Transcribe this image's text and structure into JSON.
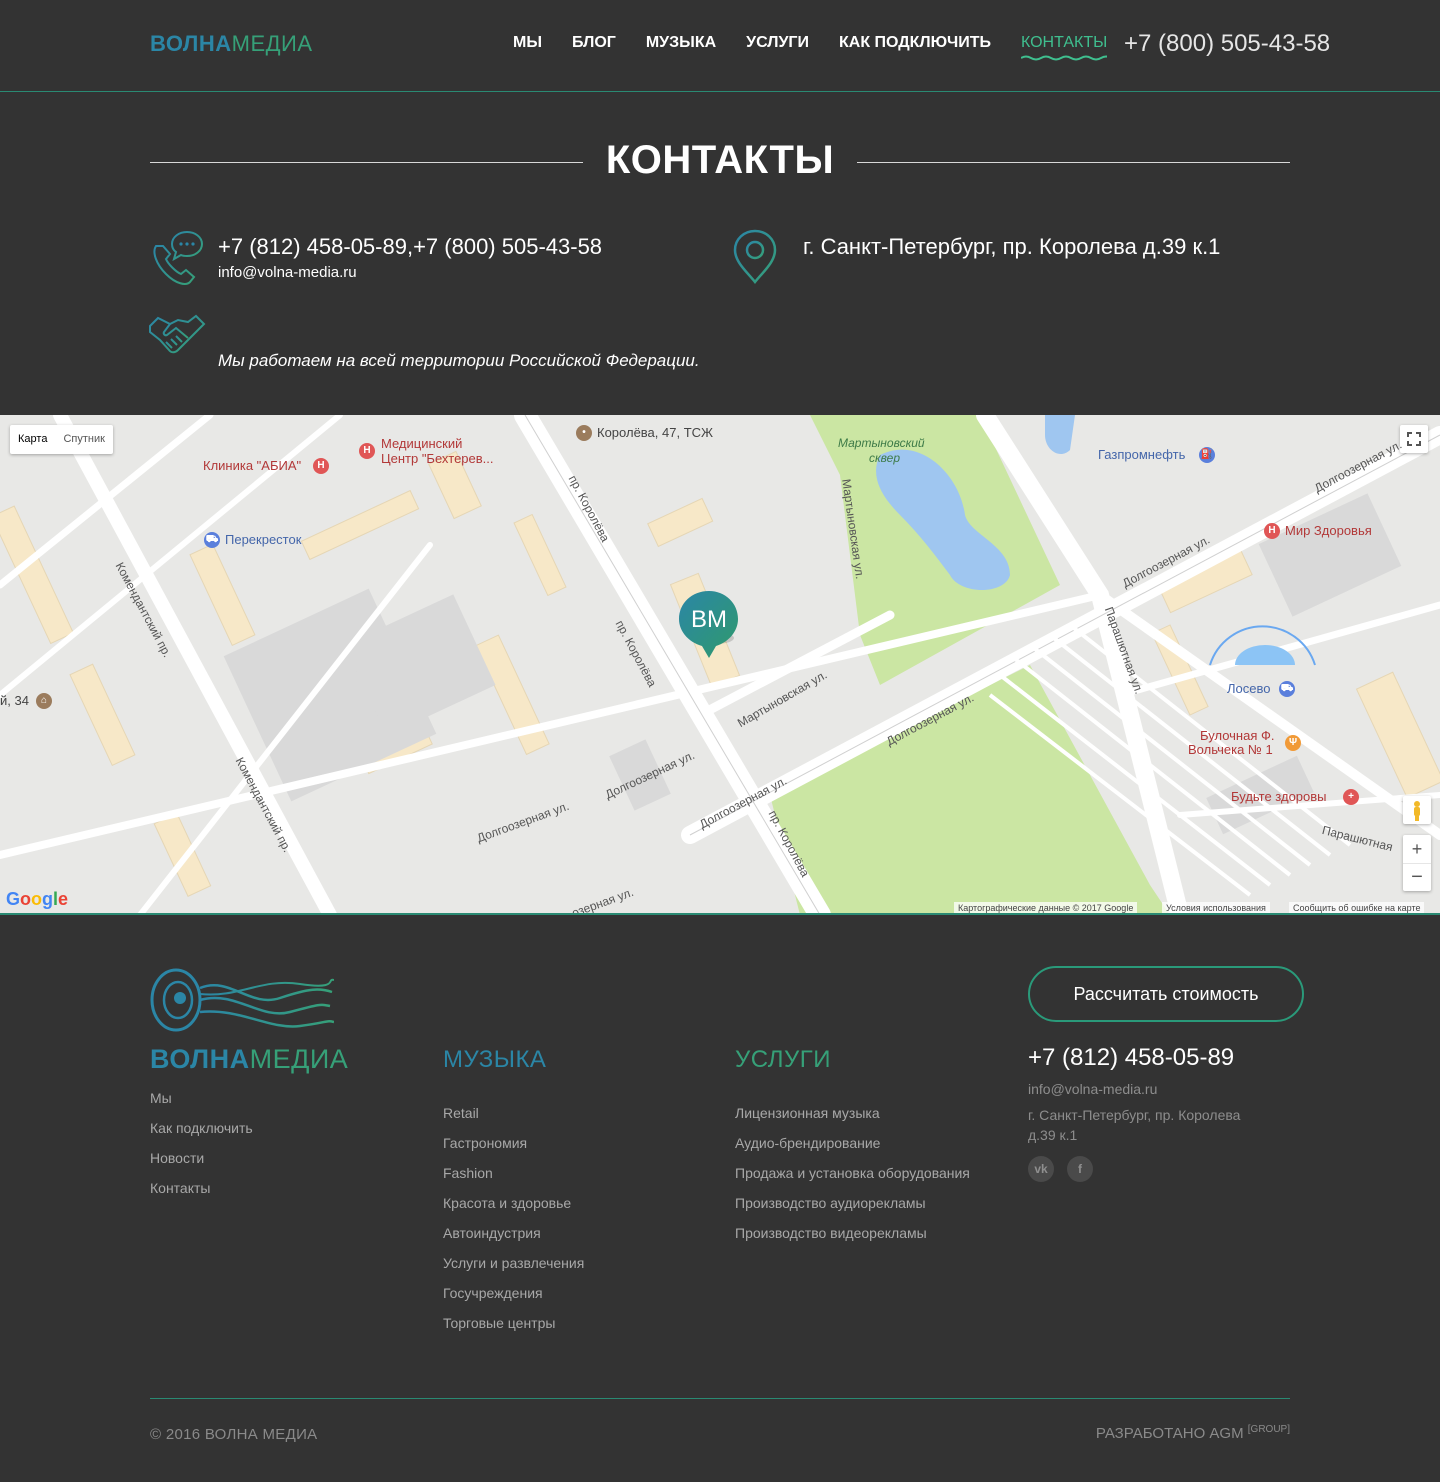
{
  "header": {
    "logo_bold": "ВОЛНА",
    "logo_light": "МЕДИА",
    "nav": [
      "МЫ",
      "БЛОГ",
      "МУЗЫКА",
      "УСЛУГИ",
      "КАК ПОДКЛЮЧИТЬ",
      "КОНТАКТЫ"
    ],
    "phone": "+7 (800) 505-43-58"
  },
  "page": {
    "title": "КОНТАКТЫ",
    "phones": "+7 (812) 458-05-89,+7 (800) 505-43-58",
    "email": "info@volna-media.ru",
    "address": "г. Санкт-Петербург, пр. Королева д.39 к.1",
    "territory": "Мы работаем на всей территории Российской Федерации."
  },
  "map": {
    "type_map": "Карта",
    "type_sat": "Спутник",
    "marker": "ВМ",
    "places": {
      "koroleva47": "Королёва, 47, ТСЖ",
      "med_center_1": "Медицинский",
      "med_center_2": "Центр \"Бехтерев...",
      "abia": "Клиника \"АБИА\"",
      "perekrestok": "Перекресток",
      "martynov_1": "Мартыновский",
      "martynov_2": "сквер",
      "gazprom": "Газпромнефть",
      "mir_zdorovya": "Мир Здоровья",
      "losevo": "Лосево",
      "bakery_1": "Булочная Ф.",
      "bakery_2": "Вольчека № 1",
      "budte": "Будьте здоровы",
      "partial": "й, 34"
    },
    "streets": {
      "komend_1": "Комендантский пр.",
      "komend_2": "Комендантский пр.",
      "korol_1": "пр. Королёва",
      "korol_2": "пр. Королёва",
      "korol_3": "пр. Королёва",
      "martyn_ul": "Мартыновская ул.",
      "martyn_ul2": "Мартыновская ул.",
      "dolg_1": "Долгоозерная ул.",
      "dolg_2": "Долгоозерная ул.",
      "dolg_3": "Долгоозерная ул.",
      "dolg_4": "Долгоозерная ул.",
      "dolg_5": "Долгоозерная ул.",
      "dolg_6": "Долгоозерная ул.",
      "dolg_7": "озерная ул.",
      "parash_1": "Парашютная ул.",
      "parash_2": "Парашютная"
    },
    "google": "Google",
    "attribution": "Картографические данные © 2017 Google",
    "terms": "Условия использования",
    "report": "Сообщить об ошибке на карте"
  },
  "footer": {
    "logo_bold": "ВОЛНА",
    "logo_light": "МЕДИА",
    "col1": [
      "Мы",
      "Как подключить",
      "Новости",
      "Контакты"
    ],
    "music_title": "МУЗЫКА",
    "music": [
      "Retail",
      "Гастрономия",
      "Fashion",
      "Красота и здоровье",
      "Автоиндустрия",
      "Услуги и развлечения",
      "Госучреждения",
      "Торговые центры"
    ],
    "services_title": "УСЛУГИ",
    "services": [
      "Лицензионная музыка",
      "Аудио-брендирование",
      "Продажа и установка оборудования",
      "Производство аудиорекламы",
      "Производство видеорекламы"
    ],
    "cta": "Рассчитать стоимость",
    "phone": "+7 (812) 458-05-89",
    "email": "info@volna-media.ru",
    "address": "г. Санкт-Петербург, пр. Королева д.39 к.1",
    "social": [
      "vk-icon",
      "facebook-icon"
    ],
    "copyright": "© 2016 ВОЛНА МЕДИА",
    "dev": "РАЗРАБОТАНО AGM",
    "dev_sup": "[GROUP]"
  },
  "colors": {
    "bg": "#333333",
    "accent_blue": "#2b86a6",
    "accent_green": "#36a078",
    "active_nav": "#3fbf8f"
  }
}
